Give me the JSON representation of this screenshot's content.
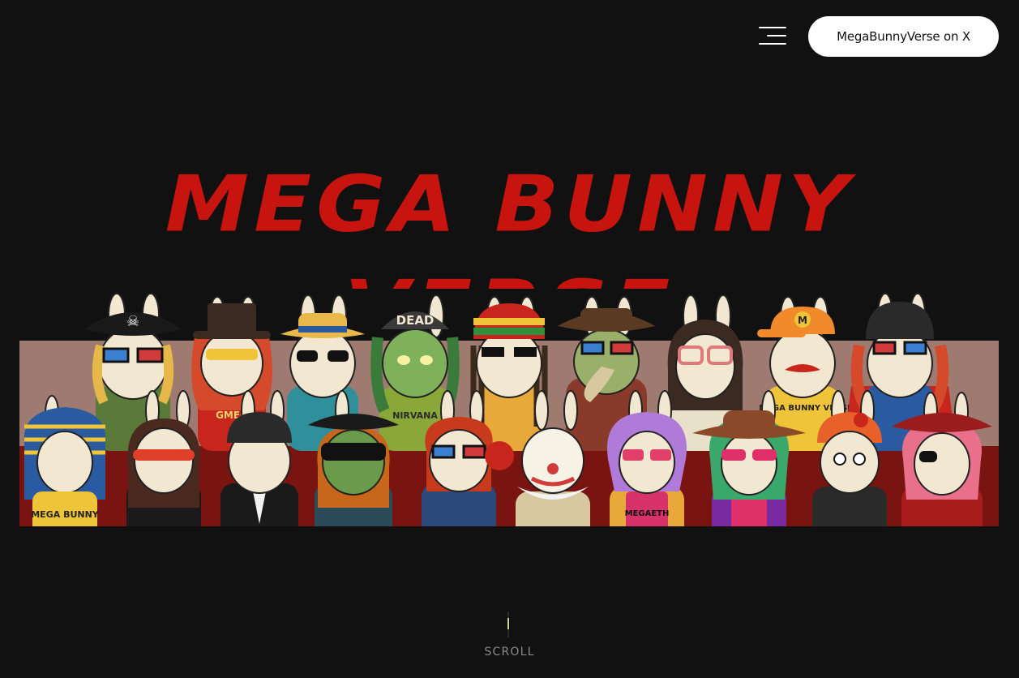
{
  "header": {
    "menu_icon": "hamburger-menu-icon",
    "x_button_label": "MegaBunnyVerse on X"
  },
  "hero": {
    "title": "MEGA BUNNY VERSE",
    "banner_image": "group-of-costumed-bunny-characters",
    "banner_text": {
      "pirate_skull": "☠",
      "dead_cap": "DEAD",
      "nirvana_shirt": "NIRVANA",
      "gmeg_shirt": "GMEG",
      "mega_bunny_verse_shirt": "MEGA BUNNY VERSE",
      "mega_bunny_tunic": "MEGA BUNNY",
      "megaeth_shirt": "MEGAETH",
      "m_cap": "M"
    }
  },
  "scroll": {
    "label": "SCROLL"
  },
  "colors": {
    "background": "#111111",
    "title_red": "#c8140f",
    "button_bg": "#ffffff",
    "scroll_accent": "#c9d68a",
    "banner_top_band": "#9e7a70",
    "banner_bottom_band": "#7a1410"
  }
}
